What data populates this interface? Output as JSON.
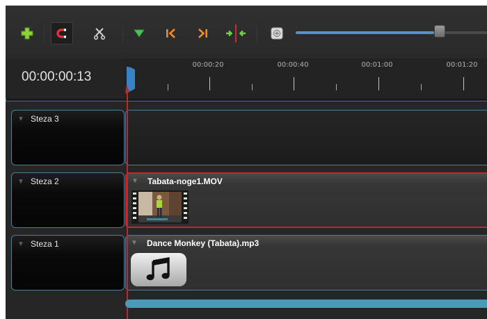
{
  "toolbar": {
    "buttons": [
      {
        "icon": "add-track-icon",
        "color": "#8cd13c"
      },
      {
        "icon": "snap-magnet-icon",
        "color": "#e8333a"
      },
      {
        "icon": "razor-scissors-icon",
        "color": "#cfcfcf"
      },
      {
        "icon": "add-marker-icon",
        "color": "#4fc05a"
      },
      {
        "icon": "previous-marker-icon",
        "color": "#f08a2a"
      },
      {
        "icon": "next-marker-icon",
        "color": "#f08a2a"
      },
      {
        "icon": "center-on-playhead-icon",
        "color": "#6fd14a"
      },
      {
        "icon": "zoom-in-icon",
        "color": "#dcdcdc"
      }
    ],
    "zoom_level": 0.77
  },
  "timeline": {
    "current_time": "00:00:00:13",
    "ruler_labels": [
      "00:00:20",
      "00:00:40",
      "00:01:00",
      "00:01:20"
    ]
  },
  "tracks": [
    {
      "name": "Steza 3",
      "clip": null
    },
    {
      "name": "Steza 2",
      "clip": {
        "title": "Tabata-noge1.MOV",
        "kind": "video",
        "selected": true
      }
    },
    {
      "name": "Steza 1",
      "clip": {
        "title": "Dance Monkey (Tabata).mp3",
        "kind": "audio",
        "selected": false
      }
    }
  ],
  "colors": {
    "accent_blue": "#4a7f96",
    "playhead": "#c0272d",
    "scrollbar": "#4a9ab8"
  }
}
